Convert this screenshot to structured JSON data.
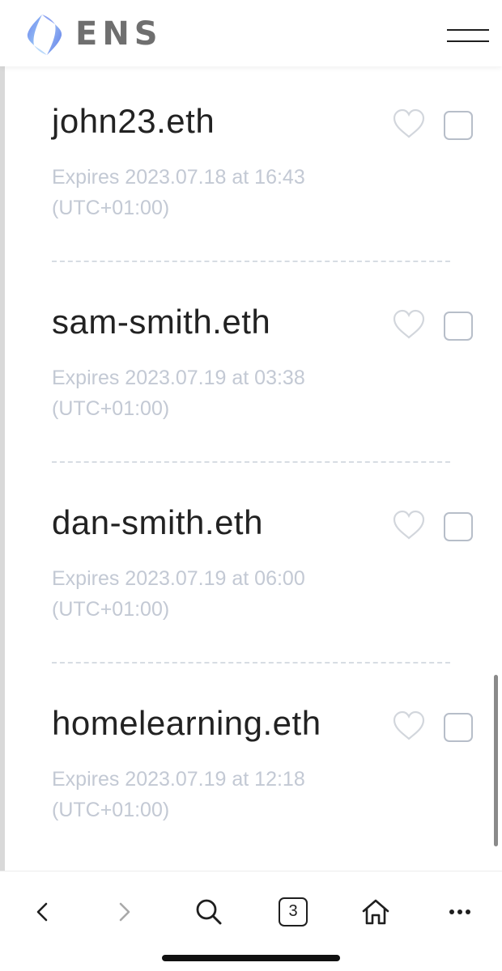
{
  "header": {
    "brand": "ENS",
    "logo_icon": "ens-logo-icon",
    "menu_icon": "hamburger-menu-icon"
  },
  "colors": {
    "text_primary": "#222222",
    "text_muted": "#c3c9d4",
    "brand_gray": "#6f6f6f",
    "logo_blue": "#7b8cf0",
    "logo_light": "#9fd3f7"
  },
  "domains": [
    {
      "name": "john23.eth",
      "expires": "Expires 2023.07.18 at 16:43",
      "timezone": "(UTC+01:00)"
    },
    {
      "name": "sam-smith.eth",
      "expires": "Expires 2023.07.19 at 03:38",
      "timezone": "(UTC+01:00)"
    },
    {
      "name": "dan-smith.eth",
      "expires": "Expires 2023.07.19 at 06:00",
      "timezone": "(UTC+01:00)"
    },
    {
      "name": "homelearning.eth",
      "expires": "Expires 2023.07.19 at 12:18",
      "timezone": "(UTC+01:00)"
    }
  ],
  "toolbar": {
    "back_icon": "chevron-left-icon",
    "forward_icon": "chevron-right-icon",
    "search_icon": "search-icon",
    "tab_count": "3",
    "home_icon": "home-icon",
    "more_icon": "more-horizontal-icon"
  }
}
